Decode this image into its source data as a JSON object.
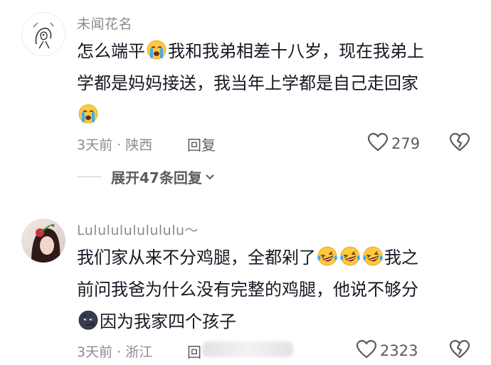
{
  "comments": [
    {
      "username": "未闻花名",
      "lines": [
        [
          {
            "t": "text",
            "v": "怎么端平"
          },
          {
            "t": "emoji",
            "v": "crying-face"
          },
          {
            "t": "text",
            "v": "我和我弟相差十八岁，现在我弟上"
          }
        ],
        [
          {
            "t": "text",
            "v": "学都是妈妈接送，我当年上学都是自己走回家"
          }
        ],
        [
          {
            "t": "emoji",
            "v": "crying-face"
          }
        ]
      ],
      "time": "3天前",
      "location": "陕西",
      "reply_label": "回复",
      "likes": "279",
      "expand_label": "展开47条回复"
    },
    {
      "username": "Lulululululululu～",
      "lines": [
        [
          {
            "t": "text",
            "v": "我们家从来不分鸡腿，全都剁了"
          },
          {
            "t": "emoji",
            "v": "laughing-crying-face"
          },
          {
            "t": "emoji",
            "v": "laughing-crying-face"
          },
          {
            "t": "emoji",
            "v": "laughing-crying-face"
          },
          {
            "t": "text",
            "v": "我之"
          }
        ],
        [
          {
            "t": "text",
            "v": "前问我爸为什么没有完整的鸡腿，他说不够分"
          }
        ],
        [
          {
            "t": "emoji",
            "v": "new-moon-face"
          },
          {
            "t": "text",
            "v": "因为我家四个孩子"
          }
        ]
      ],
      "time": "3天前",
      "location": "浙江",
      "reply_label": "回",
      "likes": "2323"
    }
  ],
  "colors": {
    "text": "#161823",
    "meta": "#8a8b91",
    "icon": "#5a5b61",
    "emoji_yellow": "#ffc83d",
    "emoji_tear": "#3fa9f5"
  }
}
